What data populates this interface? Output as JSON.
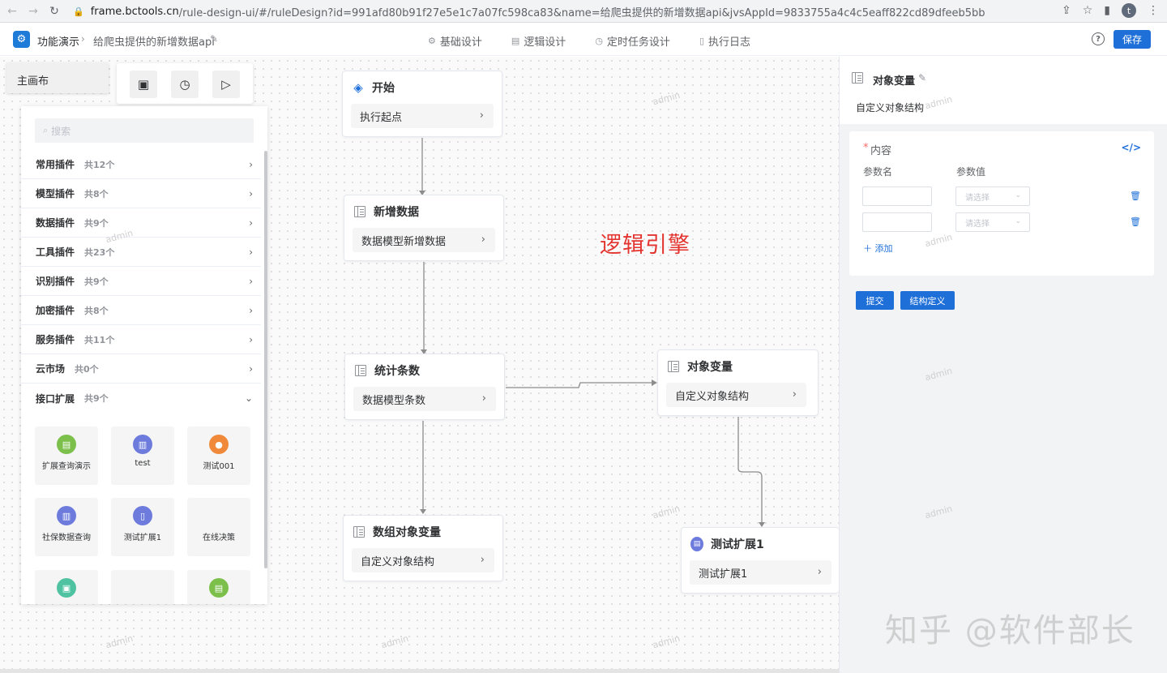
{
  "browser": {
    "url_domain": "frame.bctools.cn",
    "url_rest": "/rule-design-ui/#/ruleDesign?id=991afd80b91f27e5e1c7a07fc598ca83&name=给爬虫提供的新增数据api&jvsAppId=9833755a4c4c5eaff822cd89dfeeb5bb",
    "avatar_letter": "t"
  },
  "header": {
    "breadcrumb_root": "功能演示",
    "breadcrumb_page": "给爬虫提供的新增数据api",
    "tabs": [
      {
        "label": "基础设计",
        "icon": "gear-icon"
      },
      {
        "label": "逻辑设计",
        "icon": "table-icon"
      },
      {
        "label": "定时任务设计",
        "icon": "clock-icon"
      },
      {
        "label": "执行日志",
        "icon": "document-icon"
      }
    ],
    "help_glyph": "?",
    "save_label": "保存"
  },
  "canvas": {
    "main_tab": "主画布",
    "logic_label": "逻辑引擎",
    "watermark": "admin"
  },
  "plugins": {
    "search_placeholder": "搜索",
    "categories": [
      {
        "name": "常用插件",
        "count": "共12个"
      },
      {
        "name": "模型插件",
        "count": "共8个"
      },
      {
        "name": "数据插件",
        "count": "共9个"
      },
      {
        "name": "工具插件",
        "count": "共23个"
      },
      {
        "name": "识别插件",
        "count": "共9个"
      },
      {
        "name": "加密插件",
        "count": "共8个"
      },
      {
        "name": "服务插件",
        "count": "共11个"
      },
      {
        "name": "云市场",
        "count": "共0个"
      },
      {
        "name": "接口扩展",
        "count": "共9个"
      }
    ],
    "cards": [
      {
        "label": "扩展查询演示",
        "color": "#7cbf4b"
      },
      {
        "label": "test",
        "color": "#6c7bdc"
      },
      {
        "label": "测试001",
        "color": "#f08a3a"
      },
      {
        "label": "社保数据查询",
        "color": "#6c7bdc"
      },
      {
        "label": "测试扩展1",
        "color": "#6c7bdc"
      },
      {
        "label": "在线决策",
        "color": ""
      },
      {
        "label": "",
        "color": "#4fc3a1"
      },
      {
        "label": "",
        "color": ""
      },
      {
        "label": "",
        "color": "#7cbf4b"
      }
    ]
  },
  "nodes": {
    "start": {
      "title": "开始",
      "sub": "执行起点"
    },
    "add_data": {
      "title": "新增数据",
      "sub": "数据模型新增数据"
    },
    "count": {
      "title": "统计条数",
      "sub": "数据模型条数"
    },
    "array_var": {
      "title": "数组对象变量",
      "sub": "自定义对象结构"
    },
    "obj_var": {
      "title": "对象变量",
      "sub": "自定义对象结构"
    },
    "test_ext": {
      "title": "测试扩展1",
      "sub": "测试扩展1"
    }
  },
  "panel": {
    "title": "对象变量",
    "subtitle": "自定义对象结构",
    "content_label": "内容",
    "required_mark": "*",
    "col_name": "参数名",
    "col_value": "参数值",
    "select_placeholder": "请选择",
    "add_label": "添加",
    "submit_label": "提交",
    "struct_label": "结构定义"
  },
  "page_watermark": "知乎 @软件部长",
  "colors": {
    "primary": "#1f6fd8",
    "logic_label": "#e3342f"
  }
}
